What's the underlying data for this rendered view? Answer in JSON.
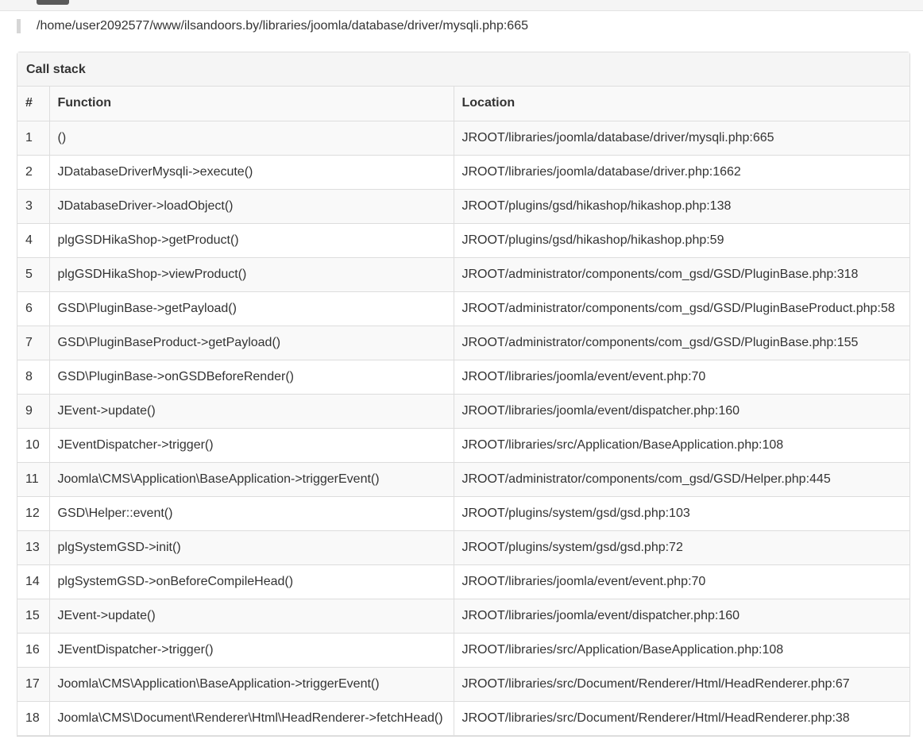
{
  "error_location": "/home/user2092577/www/ilsandoors.by/libraries/joomla/database/driver/mysqli.php:665",
  "panel": {
    "title": "Call stack",
    "columns": {
      "num": "#",
      "function": "Function",
      "location": "Location"
    },
    "rows": [
      {
        "num": "1",
        "function": "()",
        "location": "JROOT/libraries/joomla/database/driver/mysqli.php:665"
      },
      {
        "num": "2",
        "function": "JDatabaseDriverMysqli->execute()",
        "location": "JROOT/libraries/joomla/database/driver.php:1662"
      },
      {
        "num": "3",
        "function": "JDatabaseDriver->loadObject()",
        "location": "JROOT/plugins/gsd/hikashop/hikashop.php:138"
      },
      {
        "num": "4",
        "function": "plgGSDHikaShop->getProduct()",
        "location": "JROOT/plugins/gsd/hikashop/hikashop.php:59"
      },
      {
        "num": "5",
        "function": "plgGSDHikaShop->viewProduct()",
        "location": "JROOT/administrator/components/com_gsd/GSD/PluginBase.php:318"
      },
      {
        "num": "6",
        "function": "GSD\\PluginBase->getPayload()",
        "location": "JROOT/administrator/components/com_gsd/GSD/PluginBaseProduct.php:58"
      },
      {
        "num": "7",
        "function": "GSD\\PluginBaseProduct->getPayload()",
        "location": "JROOT/administrator/components/com_gsd/GSD/PluginBase.php:155"
      },
      {
        "num": "8",
        "function": "GSD\\PluginBase->onGSDBeforeRender()",
        "location": "JROOT/libraries/joomla/event/event.php:70"
      },
      {
        "num": "9",
        "function": "JEvent->update()",
        "location": "JROOT/libraries/joomla/event/dispatcher.php:160"
      },
      {
        "num": "10",
        "function": "JEventDispatcher->trigger()",
        "location": "JROOT/libraries/src/Application/BaseApplication.php:108"
      },
      {
        "num": "11",
        "function": "Joomla\\CMS\\Application\\BaseApplication->triggerEvent()",
        "location": "JROOT/administrator/components/com_gsd/GSD/Helper.php:445"
      },
      {
        "num": "12",
        "function": "GSD\\Helper::event()",
        "location": "JROOT/plugins/system/gsd/gsd.php:103"
      },
      {
        "num": "13",
        "function": "plgSystemGSD->init()",
        "location": "JROOT/plugins/system/gsd/gsd.php:72"
      },
      {
        "num": "14",
        "function": "plgSystemGSD->onBeforeCompileHead()",
        "location": "JROOT/libraries/joomla/event/event.php:70"
      },
      {
        "num": "15",
        "function": "JEvent->update()",
        "location": "JROOT/libraries/joomla/event/dispatcher.php:160"
      },
      {
        "num": "16",
        "function": "JEventDispatcher->trigger()",
        "location": "JROOT/libraries/src/Application/BaseApplication.php:108"
      },
      {
        "num": "17",
        "function": "Joomla\\CMS\\Application\\BaseApplication->triggerEvent()",
        "location": "JROOT/libraries/src/Document/Renderer/Html/HeadRenderer.php:67"
      },
      {
        "num": "18",
        "function": "Joomla\\CMS\\Document\\Renderer\\Html\\HeadRenderer->fetchHead()",
        "location": "JROOT/libraries/src/Document/Renderer/Html/HeadRenderer.php:38"
      }
    ]
  }
}
